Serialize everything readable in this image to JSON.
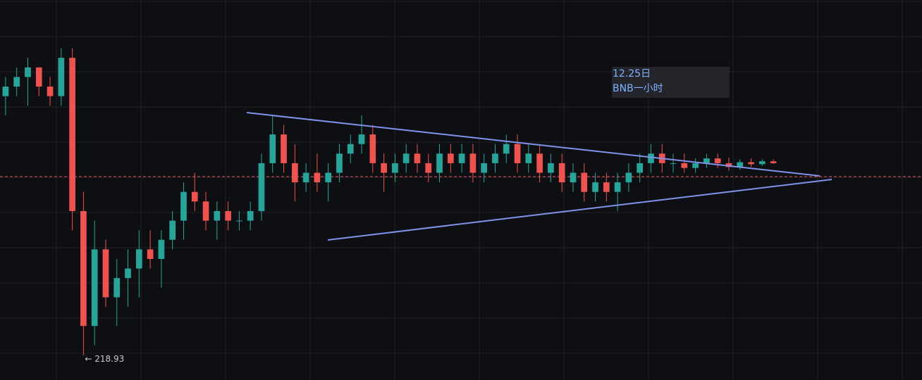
{
  "chart_data": {
    "type": "candlestick",
    "symbol_note": "BNB一小时",
    "annotation": {
      "line1": "12.25日",
      "line2": "BNB一小时"
    },
    "low_marker": {
      "text": "← 218.93"
    },
    "current_price_line": {
      "style": "dashed"
    },
    "pattern": {
      "name": "symmetrical-triangle",
      "color": "#7f93ec"
    },
    "colors": {
      "background": "#0e0f13",
      "grid": "#202228",
      "up": "#26a69a",
      "down": "#ef5350",
      "price_line": "#ef5350",
      "annotation_text": "#7fb2ff",
      "annotation_bg": "#23252a"
    },
    "grid": true,
    "candles_ohlc": [
      [
        246,
        248,
        244,
        247
      ],
      [
        247,
        249,
        246,
        248
      ],
      [
        248,
        250,
        245,
        249
      ],
      [
        249,
        249,
        246,
        247
      ],
      [
        247,
        248,
        245,
        246
      ],
      [
        246,
        251,
        245,
        250
      ],
      [
        250,
        251,
        232,
        234
      ],
      [
        234,
        236,
        218.93,
        222
      ],
      [
        222,
        233,
        220,
        230
      ],
      [
        230,
        231,
        224,
        225
      ],
      [
        225,
        229,
        222,
        227
      ],
      [
        227,
        230,
        224,
        228
      ],
      [
        228,
        232,
        225,
        230
      ],
      [
        230,
        232,
        228,
        229
      ],
      [
        229,
        232,
        226,
        231
      ],
      [
        231,
        234,
        230,
        233
      ],
      [
        233,
        237,
        231,
        236
      ],
      [
        236,
        238,
        234,
        235
      ],
      [
        235,
        236,
        232,
        233
      ],
      [
        233,
        235,
        231,
        234
      ],
      [
        234,
        235,
        232,
        233
      ],
      [
        233,
        234,
        232,
        233
      ],
      [
        233,
        235,
        232,
        234
      ],
      [
        234,
        240,
        233,
        239
      ],
      [
        239,
        244,
        238,
        242
      ],
      [
        242,
        243,
        238,
        239
      ],
      [
        239,
        241,
        235,
        237
      ],
      [
        237,
        239,
        236,
        238
      ],
      [
        238,
        240,
        236,
        237
      ],
      [
        237,
        239,
        235,
        238
      ],
      [
        238,
        241,
        237,
        240
      ],
      [
        240,
        242,
        239,
        241
      ],
      [
        241,
        244,
        240,
        242
      ],
      [
        242,
        243,
        238,
        239
      ],
      [
        239,
        240,
        236,
        238
      ],
      [
        238,
        240,
        237,
        239
      ],
      [
        239,
        241,
        238,
        240
      ],
      [
        240,
        241,
        238,
        239
      ],
      [
        239,
        240,
        237,
        238
      ],
      [
        238,
        241,
        237,
        240
      ],
      [
        240,
        241,
        238,
        239
      ],
      [
        239,
        241,
        238,
        240
      ],
      [
        240,
        241,
        237,
        238
      ],
      [
        238,
        240,
        237,
        239
      ],
      [
        239,
        241,
        238,
        240
      ],
      [
        240,
        242,
        239,
        241
      ],
      [
        241,
        242,
        238,
        239
      ],
      [
        239,
        241,
        238,
        240
      ],
      [
        240,
        241,
        237,
        238
      ],
      [
        238,
        240,
        237,
        239
      ],
      [
        239,
        240,
        236,
        237
      ],
      [
        237,
        239,
        236,
        238
      ],
      [
        238,
        239,
        235,
        236
      ],
      [
        236,
        238,
        235,
        237
      ],
      [
        237,
        238,
        235,
        236
      ],
      [
        236,
        238,
        234,
        237
      ],
      [
        237,
        239,
        236,
        238
      ],
      [
        238,
        240,
        237,
        239
      ],
      [
        239,
        241,
        238,
        240
      ],
      [
        240,
        241,
        238,
        239
      ],
      [
        239,
        240,
        238,
        239
      ],
      [
        239,
        240,
        238,
        238.5
      ],
      [
        238.5,
        239.5,
        238,
        239
      ],
      [
        239,
        240,
        238.5,
        239.5
      ],
      [
        239.5,
        240,
        238.5,
        239
      ],
      [
        239,
        239.6,
        238.2,
        238.6
      ],
      [
        238.6,
        239.4,
        238.3,
        239.1
      ],
      [
        239.1,
        239.5,
        238.6,
        238.9
      ],
      [
        238.9,
        239.4,
        238.7,
        239.2
      ],
      [
        239.2,
        239.4,
        238.9,
        239.0
      ]
    ]
  }
}
